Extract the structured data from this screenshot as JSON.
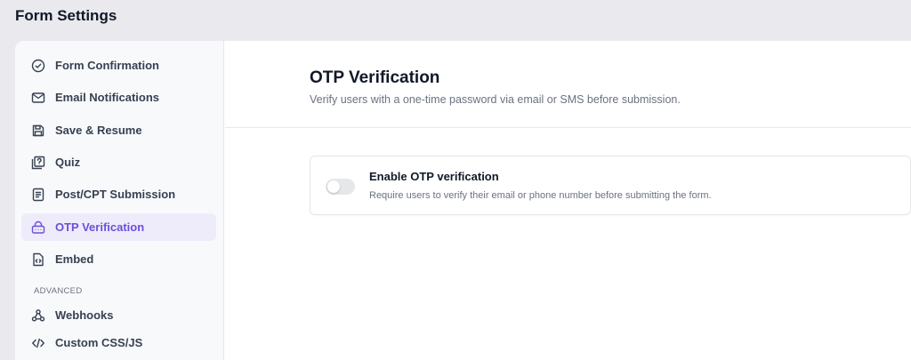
{
  "page": {
    "title": "Form Settings"
  },
  "sidebar": {
    "items": [
      {
        "label": "Form Confirmation",
        "icon": "check-circle-icon",
        "active": false
      },
      {
        "label": "Email Notifications",
        "icon": "mail-icon",
        "active": false
      },
      {
        "label": "Save & Resume",
        "icon": "save-icon",
        "active": false
      },
      {
        "label": "Quiz",
        "icon": "quiz-icon",
        "active": false
      },
      {
        "label": "Post/CPT Submission",
        "icon": "document-icon",
        "active": false
      },
      {
        "label": "OTP Verification",
        "icon": "otp-icon",
        "active": true
      },
      {
        "label": "Embed",
        "icon": "embed-icon",
        "active": false
      }
    ],
    "advanced_label": "ADVANCED",
    "advanced_items": [
      {
        "label": "Webhooks",
        "icon": "webhook-icon",
        "active": false
      },
      {
        "label": "Custom CSS/JS",
        "icon": "code-icon",
        "active": false
      }
    ]
  },
  "content": {
    "title": "OTP Verification",
    "subtitle": "Verify users with a one-time password via email or SMS before submission.",
    "setting": {
      "title": "Enable OTP verification",
      "description": "Require users to verify their email or phone number before submitting the form.",
      "enabled": false
    }
  },
  "colors": {
    "accent": "#6d4fd9",
    "active_bg": "#eeecfb",
    "sidebar_bg": "#f8f9fb",
    "page_bg": "#e9e9ee"
  }
}
